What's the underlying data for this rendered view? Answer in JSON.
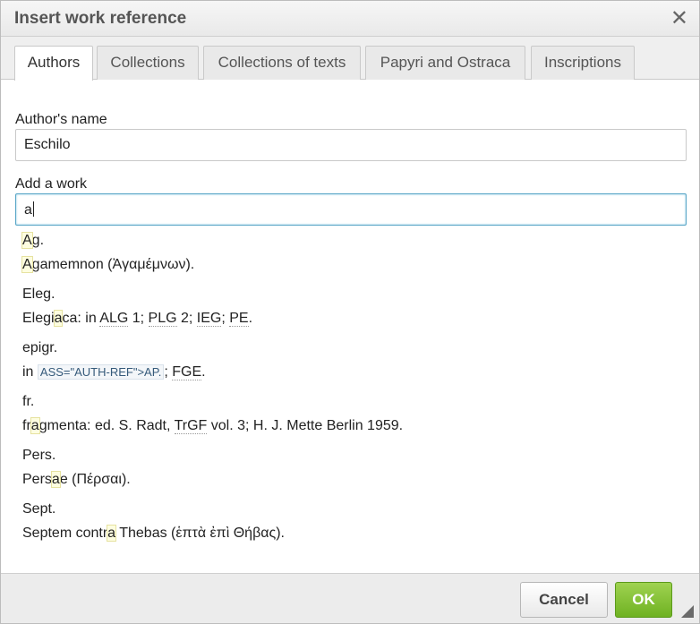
{
  "dialog": {
    "title": "Insert work reference",
    "close_glyph": "✕"
  },
  "tabs": [
    {
      "label": "Authors",
      "active": true
    },
    {
      "label": "Collections",
      "active": false
    },
    {
      "label": "Collections of texts",
      "active": false
    },
    {
      "label": "Papyri and Ostraca",
      "active": false
    },
    {
      "label": "Inscriptions",
      "active": false
    }
  ],
  "author": {
    "label": "Author's name",
    "value": "Eschilo"
  },
  "work": {
    "label": "Add a work",
    "value": "a"
  },
  "suggestions": [
    {
      "abbr_hl": "A",
      "abbr_rest": "g.",
      "full_pre": "",
      "full_hl": "A",
      "full_post": "gamemnon (Ἀγαμέμνων)."
    },
    {
      "abbr": "Eleg.",
      "full_pre": "Elegi",
      "full_hl": "a",
      "full_post": "ca: in ",
      "refs": [
        "ALG",
        "PLG",
        "IEG",
        "PE"
      ]
    },
    {
      "abbr": "epigr.",
      "full_pre": "in ",
      "code": "ASS=\"AUTH-REF\"",
      "code_post": ">AP.",
      "ref": "FGE"
    },
    {
      "abbr": "fr.",
      "full_pre": "fr",
      "full_hl": "a",
      "full_post": "gmenta: ed. S. Radt, ",
      "ref": "TrGF",
      "tail": " vol. 3; H. J. Mette Berlin 1959."
    },
    {
      "abbr": "Pers.",
      "full_pre": "Pers",
      "full_hl": "a",
      "full_post": "e (Πέρσαι)."
    },
    {
      "abbr": "Sept.",
      "full_pre": "Septem contr",
      "full_hl": "a",
      "full_post": " Thebas (ἑπτὰ ἐπὶ Θήβας)."
    }
  ],
  "footer": {
    "cancel_label": "Cancel",
    "ok_label": "OK"
  }
}
